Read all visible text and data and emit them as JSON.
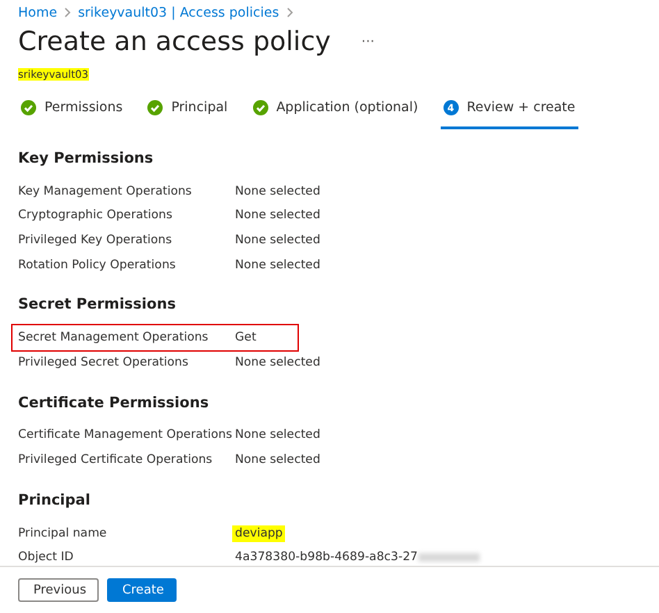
{
  "breadcrumb": [
    {
      "label": "Home"
    },
    {
      "label": "srikeyvault03 | Access policies"
    }
  ],
  "title": "Create an access policy",
  "more": "···",
  "subtitle": {
    "text": "srikeyvault03",
    "highlighted": true
  },
  "steps": [
    {
      "label": "Permissions",
      "completed": true,
      "selected": false
    },
    {
      "label": "Principal",
      "completed": true,
      "selected": false
    },
    {
      "label": "Application (optional)",
      "completed": true,
      "selected": false
    },
    {
      "label": "Review + create",
      "completed": false,
      "number": "4",
      "selected": true
    }
  ],
  "sections": [
    {
      "heading": "Key Permissions",
      "rows": [
        {
          "label": "Key Management Operations",
          "value": "None selected",
          "outlined": false,
          "highlighted": false
        },
        {
          "label": "Cryptographic Operations",
          "value": "None selected",
          "outlined": false,
          "highlighted": false
        },
        {
          "label": "Privileged Key Operations",
          "value": "None selected",
          "outlined": false,
          "highlighted": false
        },
        {
          "label": "Rotation Policy Operations",
          "value": "None selected",
          "outlined": false,
          "highlighted": false
        }
      ]
    },
    {
      "heading": "Secret Permissions",
      "rows": [
        {
          "label": "Secret Management Operations",
          "value": "Get",
          "outlined": true,
          "highlighted": false
        },
        {
          "label": "Privileged Secret Operations",
          "value": "None selected",
          "outlined": false,
          "highlighted": false
        }
      ]
    },
    {
      "heading": "Certificate Permissions",
      "rows": [
        {
          "label": "Certificate Management Operations",
          "value": "None selected",
          "outlined": false,
          "highlighted": false
        },
        {
          "label": "Privileged Certificate Operations",
          "value": "None selected",
          "outlined": false,
          "highlighted": false
        }
      ]
    },
    {
      "heading": "Principal",
      "rows": [
        {
          "label": "Principal name",
          "value": "deviapp",
          "outlined": false,
          "highlighted": true
        },
        {
          "label": "Object ID",
          "value": "4a378380-b98b-4689-a8c3-27",
          "outlined": false,
          "highlighted": false,
          "redacted": true
        }
      ]
    }
  ],
  "buttons": [
    {
      "label": "Previous",
      "kind": "secondary"
    },
    {
      "label": "Create",
      "kind": "primary"
    }
  ]
}
